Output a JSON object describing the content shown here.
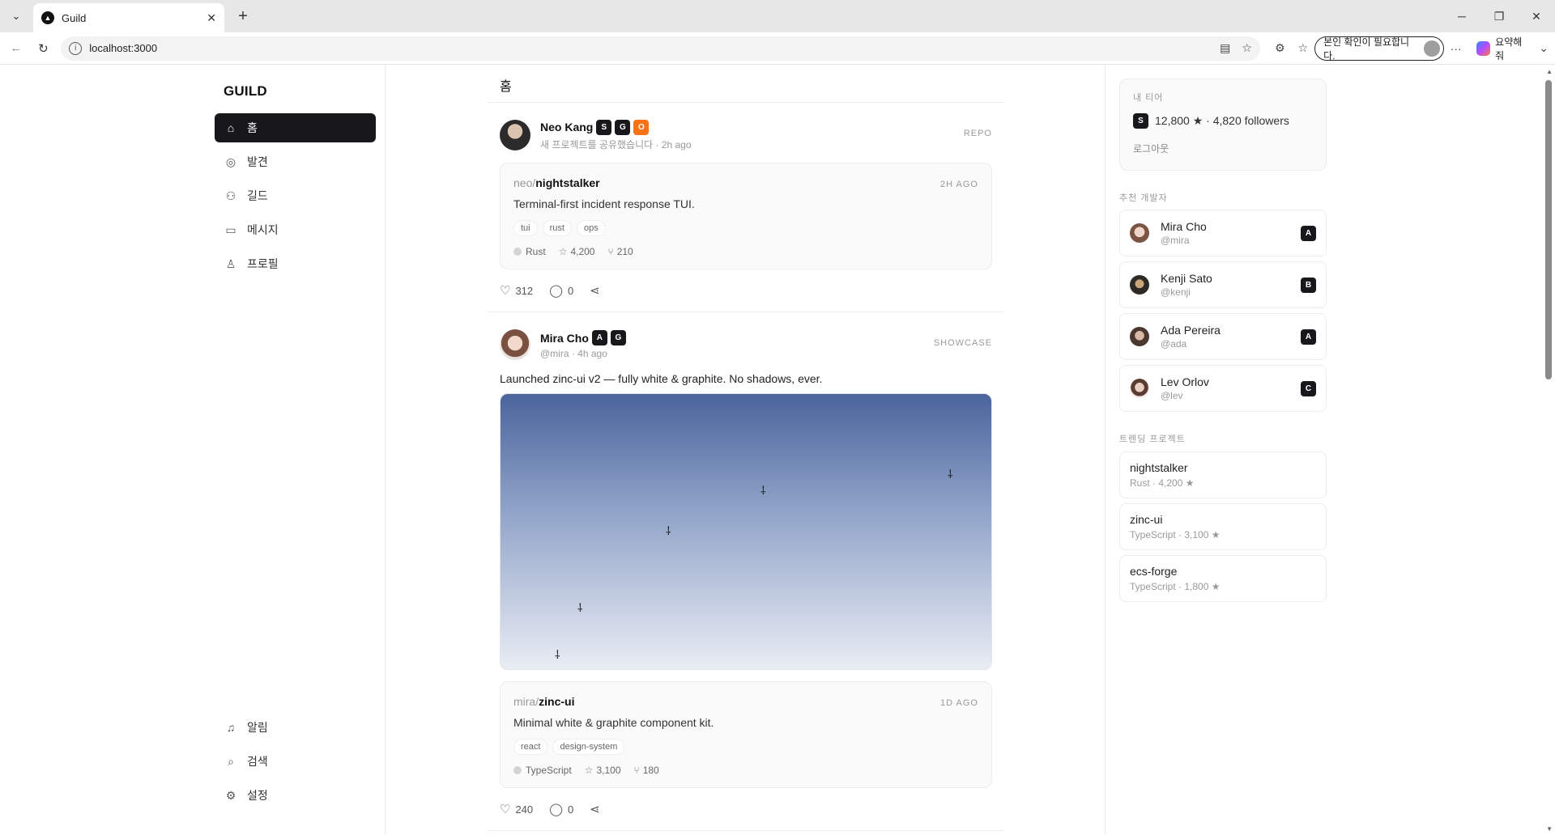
{
  "browser": {
    "tab_title": "Guild",
    "url": "localhost:3000",
    "verify_label": "본인 확인이 필요합니다.",
    "copilot_label": "요약해 줘"
  },
  "nav": {
    "brand": "GUILD",
    "items": [
      {
        "label": "홈",
        "icon": "home-icon",
        "active": true
      },
      {
        "label": "발견",
        "icon": "compass-icon",
        "active": false
      },
      {
        "label": "길드",
        "icon": "users-icon",
        "active": false
      },
      {
        "label": "메시지",
        "icon": "message-icon",
        "active": false
      },
      {
        "label": "프로필",
        "icon": "user-icon",
        "active": false
      }
    ],
    "bottom_items": [
      {
        "label": "알림",
        "icon": "bell-icon"
      },
      {
        "label": "검색",
        "icon": "search-icon"
      },
      {
        "label": "설정",
        "icon": "gear-icon"
      }
    ]
  },
  "feed": {
    "title": "홈",
    "posts": [
      {
        "author": "Neo Kang",
        "badges": [
          "S",
          "G",
          "O"
        ],
        "sub": "새 프로젝트를 공유했습니다 · 2h ago",
        "kind": "REPO",
        "repo": {
          "owner": "neo/",
          "name": "nightstalker",
          "ago": "2H AGO",
          "desc": "Terminal-first incident response TUI.",
          "tags": [
            "tui",
            "rust",
            "ops"
          ],
          "lang": "Rust",
          "stars": "4,200",
          "forks": "210"
        },
        "likes": "312",
        "comments": "0"
      },
      {
        "author": "Mira Cho",
        "badges": [
          "A",
          "G"
        ],
        "sub": "@mira · 4h ago",
        "kind": "SHOWCASE",
        "text": "Launched zinc-ui v2 — fully white & graphite. No shadows, ever.",
        "repo": {
          "owner": "mira/",
          "name": "zinc-ui",
          "ago": "1D AGO",
          "desc": "Minimal white & graphite component kit.",
          "tags": [
            "react",
            "design-system"
          ],
          "lang": "TypeScript",
          "stars": "3,100",
          "forks": "180"
        },
        "likes": "240",
        "comments": "0"
      }
    ]
  },
  "sidebar": {
    "tier": {
      "label": "내 티어",
      "badge": "S",
      "summary": "12,800 ★ · 4,820 followers",
      "logout": "로그아웃"
    },
    "devs_label": "추천 개발자",
    "devs": [
      {
        "name": "Mira Cho",
        "handle": "@mira",
        "tier": "A"
      },
      {
        "name": "Kenji Sato",
        "handle": "@kenji",
        "tier": "B"
      },
      {
        "name": "Ada Pereira",
        "handle": "@ada",
        "tier": "A"
      },
      {
        "name": "Lev Orlov",
        "handle": "@lev",
        "tier": "C"
      }
    ],
    "trending_label": "트렌딩 프로젝트",
    "trending": [
      {
        "name": "nightstalker",
        "meta": "Rust · 4,200 ★"
      },
      {
        "name": "zinc-ui",
        "meta": "TypeScript · 3,100 ★"
      },
      {
        "name": "ecs-forge",
        "meta": "TypeScript · 1,800 ★"
      }
    ]
  },
  "colors": {
    "accent": "#18181b",
    "orange_badge": "#f97316"
  }
}
